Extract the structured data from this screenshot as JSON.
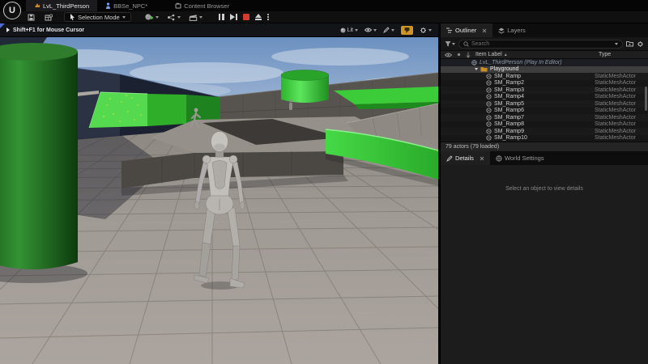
{
  "app": {
    "logo": "U",
    "tabs": [
      {
        "label": "LvL_ThirdPerson"
      },
      {
        "label": "BBSe_NPC*"
      },
      {
        "label": "Content Browser"
      }
    ]
  },
  "toolbar": {
    "selection_mode_label": "Selection Mode"
  },
  "viewport": {
    "hint": "Shift+F1 for Mouse Cursor",
    "view_mode_label": "Lit"
  },
  "outliner": {
    "tab_label": "Outliner",
    "layers_tab_label": "Layers",
    "search_placeholder": "Search",
    "columns": {
      "item_label": "Item Label",
      "sort_asc": "▲",
      "type": "Type"
    },
    "world_row_label": "LvL_ThirdPerson (Play In Editor)",
    "folder_label": "Playground",
    "rows": [
      {
        "name": "SM_Ramp",
        "type": "StaticMeshActor"
      },
      {
        "name": "SM_Ramp2",
        "type": "StaticMeshActor"
      },
      {
        "name": "SM_Ramp3",
        "type": "StaticMeshActor"
      },
      {
        "name": "SM_Ramp4",
        "type": "StaticMeshActor"
      },
      {
        "name": "SM_Ramp5",
        "type": "StaticMeshActor"
      },
      {
        "name": "SM_Ramp6",
        "type": "StaticMeshActor"
      },
      {
        "name": "SM_Ramp7",
        "type": "StaticMeshActor"
      },
      {
        "name": "SM_Ramp8",
        "type": "StaticMeshActor"
      },
      {
        "name": "SM_Ramp9",
        "type": "StaticMeshActor"
      },
      {
        "name": "SM_Ramp10",
        "type": "StaticMeshActor"
      }
    ],
    "status": "79 actors (79 loaded)"
  },
  "details": {
    "tab_label": "Details",
    "world_settings_label": "World Settings",
    "empty_text": "Select an object to view details"
  },
  "colors": {
    "accent_yellow": "#cf9426",
    "stop_red": "#d23b2e",
    "green_bright": "#3ed63e",
    "green_dark": "#1c611c",
    "sky_top": "#6b90c0",
    "sky_horizon": "#c6d2e2"
  }
}
